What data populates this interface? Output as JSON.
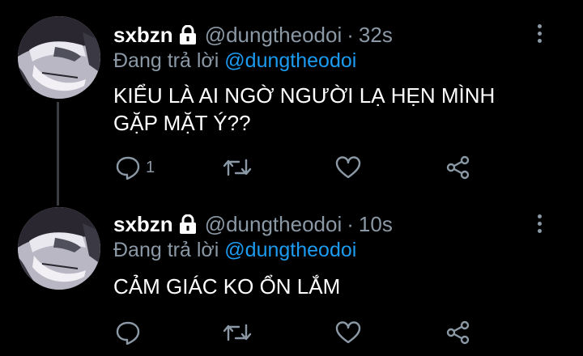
{
  "tweets": [
    {
      "author_name": "sxbzn",
      "handle": "@dungtheodoi",
      "separator": "·",
      "time": "32s",
      "replying_prefix": "Đang trả lời",
      "replying_to": "@dungtheodoi",
      "text_line1": "KIỂU LÀ AI NGỜ NGƯỜI LẠ HẸN MÌNH",
      "text_line2": "GẶP MẶT Ý??",
      "reply_count": "1"
    },
    {
      "author_name": "sxbzn",
      "handle": "@dungtheodoi",
      "separator": "·",
      "time": "10s",
      "replying_prefix": "Đang trả lời",
      "replying_to": "@dungtheodoi",
      "text_line1": "CẢM GIÁC KO ỔN LẮM",
      "text_line2": "",
      "reply_count": ""
    }
  ],
  "icons": {
    "lock": "lock-icon",
    "more": "more-vertical-icon",
    "reply": "reply-icon",
    "retweet": "retweet-icon",
    "like": "heart-icon",
    "share": "share-icon"
  },
  "colors": {
    "background": "#000000",
    "secondary_text": "#8b98a5",
    "mention": "#1d9bf0",
    "thread_line": "#3a3d42"
  }
}
